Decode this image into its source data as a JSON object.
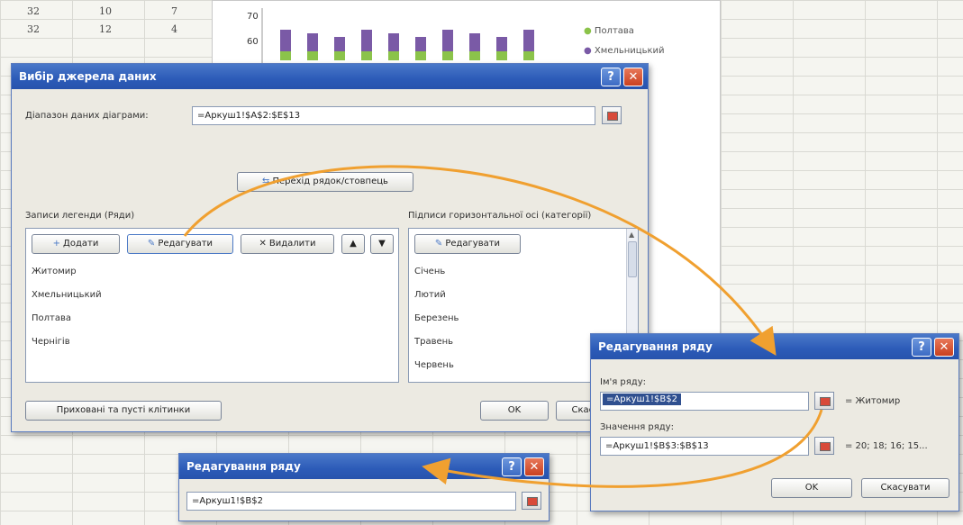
{
  "sheet": {
    "rows": [
      [
        "32",
        "10",
        "7"
      ],
      [
        "32",
        "12",
        "4"
      ]
    ]
  },
  "chart": {
    "ticks": [
      "70",
      "60"
    ],
    "legend": [
      "Полтава",
      "Хмельницький"
    ],
    "colors": {
      "purple": "#7a5aa6",
      "green": "#8bc34a",
      "accent": "#f0a030"
    }
  },
  "main_dialog": {
    "title": "Вибір джерела даних",
    "range_label": "Діапазон даних діаграми:",
    "range_value": "=Аркуш1!$A$2:$E$13",
    "switch_button": "Перехід рядок/стовпець",
    "legend_label": "Записи легенди (Ряди)",
    "add_button": "Додати",
    "edit_button": "Редагувати",
    "delete_button": "Видалити",
    "up_button": "▲",
    "down_button": "▼",
    "series": [
      "Житомир",
      "Хмельницький",
      "Полтава",
      "Чернігів"
    ],
    "axis_label": "Підписи горизонтальної осі (категорії)",
    "axis_edit_button": "Редагувати",
    "categories": [
      "Січень",
      "Лютий",
      "Березень",
      "Травень",
      "Червень"
    ],
    "hidden_cells_button": "Приховані та пусті клітинки",
    "ok_button": "OK",
    "cancel_button": "Скасувати"
  },
  "edit_dialog_right": {
    "title": "Редагування ряду",
    "name_label": "Ім'я ряду:",
    "name_value": "=Аркуш1!$B$2",
    "name_result": "= Житомир",
    "values_label": "Значення ряду:",
    "values_value": "=Аркуш1!$B$3:$B$13",
    "values_result": "= 20; 18; 16; 15...",
    "ok_button": "OK",
    "cancel_button": "Скасувати"
  },
  "edit_dialog_bottom": {
    "title": "Редагування ряду",
    "value": "=Аркуш1!$B$2"
  }
}
